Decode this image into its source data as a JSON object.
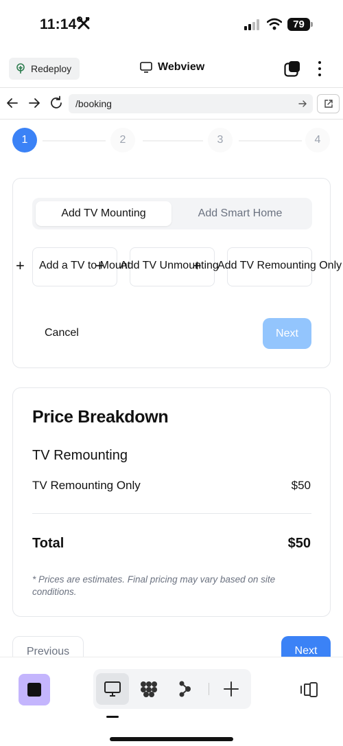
{
  "status": {
    "time": "11:14",
    "battery": "79"
  },
  "header": {
    "redeploy_label": "Redeploy",
    "title": "Webview"
  },
  "urlbar": {
    "url": "/booking"
  },
  "stepper": {
    "steps": [
      "1",
      "2",
      "3",
      "4"
    ],
    "active": "1"
  },
  "booking": {
    "tabs": [
      "Add TV Mounting",
      "Add Smart Home"
    ],
    "options": [
      "Add a TV to Mount",
      "Add TV Unmounting",
      "Add TV Remounting Only"
    ],
    "cancel_label": "Cancel",
    "next_label": "Next"
  },
  "price": {
    "title": "Price Breakdown",
    "section": "TV Remounting",
    "item_label": "TV Remounting Only",
    "item_price": "$50",
    "total_label": "Total",
    "total_value": "$50",
    "note": "* Prices are estimates. Final pricing may vary based on site conditions."
  },
  "nav": {
    "previous_label": "Previous",
    "next_label": "Next"
  },
  "colors": {
    "accent": "#3b82f6",
    "accent_disabled": "#93c5fd",
    "tool_purple": "#c4b5fd"
  }
}
